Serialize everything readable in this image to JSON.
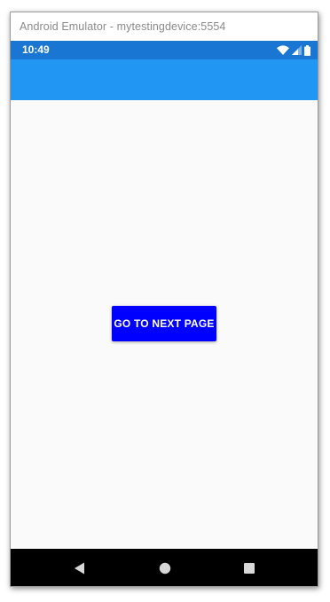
{
  "window": {
    "title": "Android Emulator - mytestingdevice:5554"
  },
  "statusbar": {
    "time": "10:49",
    "icons": [
      "wifi-icon",
      "signal-icon",
      "battery-icon"
    ],
    "color": "#1976d2"
  },
  "appbar": {
    "color": "#2196f3"
  },
  "main": {
    "button_label": "GO TO NEXT PAGE",
    "button_color": "#0000ff",
    "background": "#fafafa"
  },
  "navbar": {
    "buttons": [
      "back-icon",
      "home-icon",
      "recents-icon"
    ]
  }
}
